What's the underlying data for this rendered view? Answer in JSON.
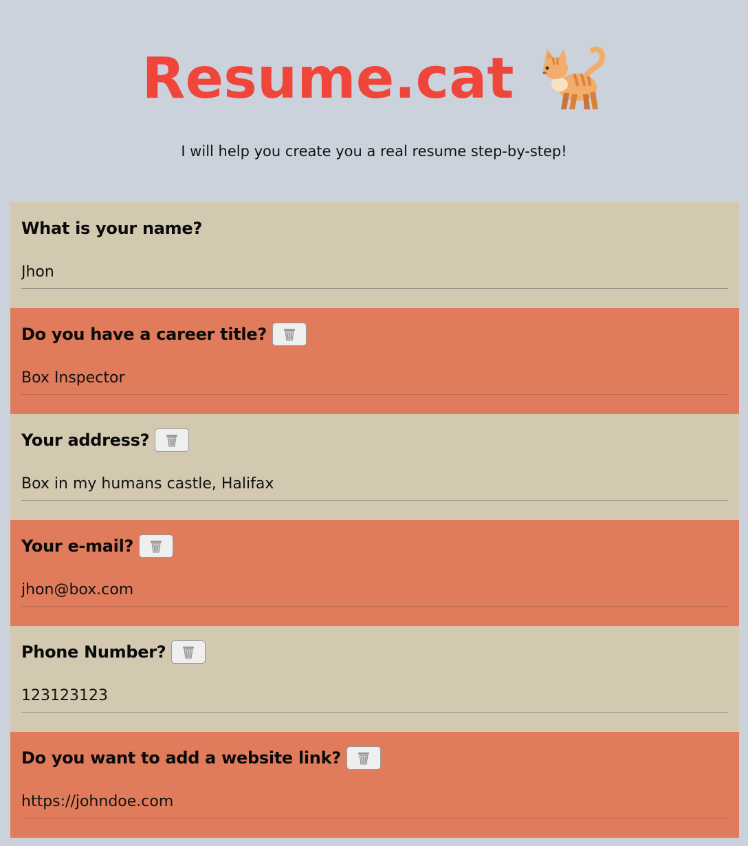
{
  "header": {
    "title": "Resume.cat",
    "subtitle": "I will help you create you a real resume step-by-step!"
  },
  "colors": {
    "background": "#cbd2db",
    "title": "#f0453a",
    "beige_card": "#d3c9b1",
    "orange_card": "#e07c5b"
  },
  "questions": [
    {
      "label": "What is your name?",
      "answer": "Jhon",
      "deletable": false,
      "icon": "trash-icon"
    },
    {
      "label": "Do you have a career title?",
      "answer": "Box Inspector",
      "deletable": true,
      "icon": "trash-icon"
    },
    {
      "label": "Your address?",
      "answer": "Box in my humans castle, Halifax",
      "deletable": true,
      "icon": "trash-icon"
    },
    {
      "label": "Your e-mail?",
      "answer": "jhon@box.com",
      "deletable": true,
      "icon": "trash-icon"
    },
    {
      "label": "Phone Number?",
      "answer": "123123123",
      "deletable": true,
      "icon": "trash-icon"
    },
    {
      "label": "Do you want to add a website link?",
      "answer": "https://johndoe.com",
      "deletable": true,
      "icon": "trash-icon"
    }
  ]
}
